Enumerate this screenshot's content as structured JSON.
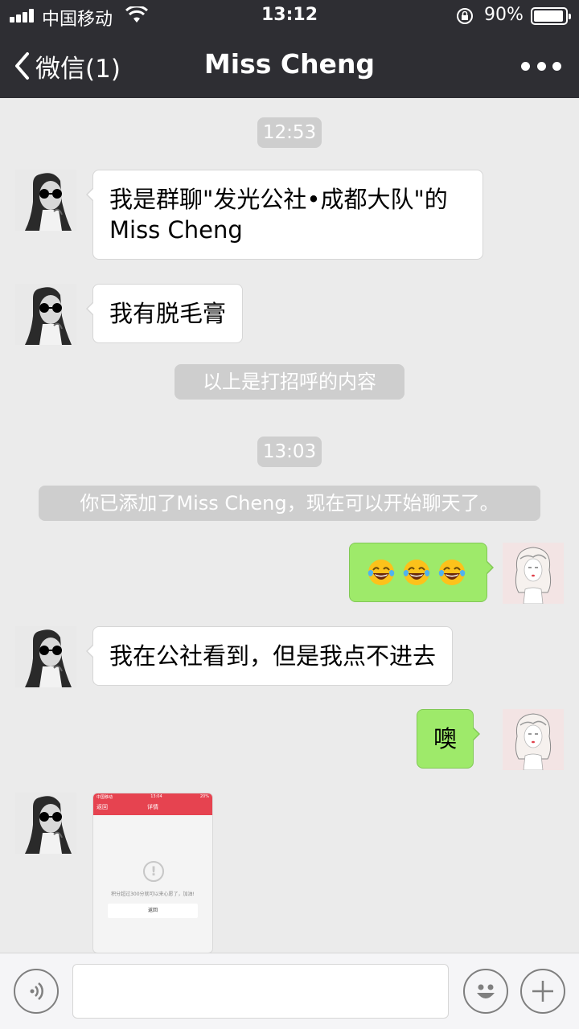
{
  "status_bar": {
    "carrier": "中国移动",
    "time": "13:12",
    "battery": "90%",
    "battery_level": 0.9
  },
  "nav": {
    "back_label": "微信(1)",
    "title": "Miss Cheng"
  },
  "messages": {
    "time_1": "12:53",
    "msg_1": "我是群聊\"发光公社•成都大队\"的Miss Cheng",
    "msg_2": "我有脱毛膏",
    "sys_1": "以上是打招呼的内容",
    "time_2": "13:03",
    "sys_2": "你已添加了Miss Cheng，现在可以开始聊天了。",
    "msg_3_emoji": [
      "face-with-tears-of-joy-icon",
      "face-with-tears-of-joy-icon",
      "face-with-tears-of-joy-icon"
    ],
    "msg_4": "我在公社看到，但是我点不进去",
    "msg_5": "噢"
  },
  "image_message": {
    "carrier": "中国移动",
    "time": "13:04",
    "battery": "20%",
    "back": "返回",
    "title": "详情",
    "body": "积分超过300分就可以来心愿了，加油!",
    "button": "返回"
  },
  "input_bar": {
    "value": "",
    "placeholder": ""
  },
  "colors": {
    "nav_bg": "#2e2e33",
    "chat_bg": "#ebebeb",
    "self_bubble": "#9eea6a",
    "other_bubble": "#ffffff",
    "pill": "#cecece"
  }
}
